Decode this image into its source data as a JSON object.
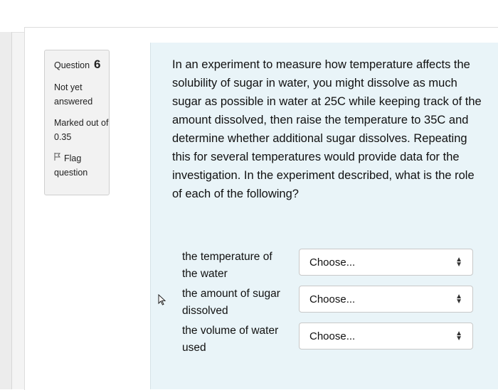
{
  "info": {
    "question_label": "Question",
    "question_number": "6",
    "status_line1": "Not yet",
    "status_line2": "answered",
    "marked_line1": "Marked out of",
    "marked_line2": "0.35",
    "flag_line1": "Flag",
    "flag_line2": "question"
  },
  "question": {
    "text": "In an experiment to measure how temperature affects the solubility of sugar in water, you might dissolve as much sugar as possible in water at 25C while keeping track of the amount dissolved, then raise the temperature to 35C and determine whether additional sugar dissolves. Repeating this for several temperatures would provide data for the investigation. In the experiment described, what is the role of each of the following?"
  },
  "matches": [
    {
      "label_line1": "the temperature of",
      "label_line2": "the water",
      "selected": "Choose..."
    },
    {
      "label_line1": "the amount of sugar",
      "label_line2": "dissolved",
      "selected": "Choose..."
    },
    {
      "label_line1": "the volume of water",
      "label_line2": "used",
      "selected": "Choose..."
    }
  ],
  "icons": {
    "flag": "flag-icon",
    "select_arrows": "up-down-arrows-icon",
    "cursor": "mouse-pointer-icon"
  }
}
